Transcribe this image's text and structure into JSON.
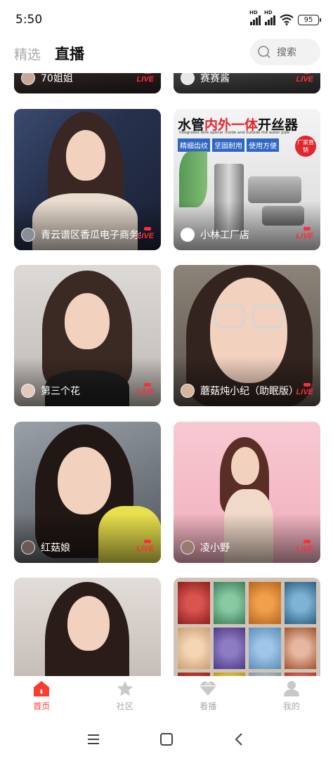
{
  "status_bar": {
    "time": "5:50",
    "signal1_label": "HD",
    "signal2_label": "HD",
    "battery": "95"
  },
  "header": {
    "tabs": [
      {
        "label": "精选",
        "active": false
      },
      {
        "label": "直播",
        "active": true
      }
    ],
    "search_placeholder": "搜索"
  },
  "live_badge": "LIVE",
  "cards": [
    {
      "name": "70姐姐",
      "live": true
    },
    {
      "name": "赛赛酱",
      "live": true
    },
    {
      "name": "青云谱区香瓜电子商务经",
      "live": true
    },
    {
      "name": "小林工厂店",
      "live": true,
      "poster_title_a": "水管",
      "poster_title_b": "内外一体",
      "poster_title_c": "开丝器",
      "poster_subtitle": "Integrated wire opener inside and outside the water pipe",
      "poster_tags": [
        "精细齿纹",
        "坚固耐用",
        "使用方便"
      ],
      "poster_badge": "厂家直销"
    },
    {
      "name": "第三个花",
      "live": true
    },
    {
      "name": "蘑菇炖小纪（助眠版）",
      "live": true
    },
    {
      "name": "红菇娘",
      "live": true
    },
    {
      "name": "凌小野",
      "live": true
    },
    {
      "name": "",
      "live": false
    },
    {
      "name": "",
      "live": false
    }
  ],
  "bottom_nav": [
    {
      "label": "首页",
      "icon": "home-icon",
      "active": true
    },
    {
      "label": "社区",
      "icon": "star-icon",
      "active": false
    },
    {
      "label": "看播",
      "icon": "diamond-icon",
      "active": false
    },
    {
      "label": "我的",
      "icon": "profile-icon",
      "active": false
    }
  ],
  "colors": {
    "accent": "#ff3b30",
    "live_red": "#ff2d3a",
    "inactive": "#aaaaaa"
  }
}
